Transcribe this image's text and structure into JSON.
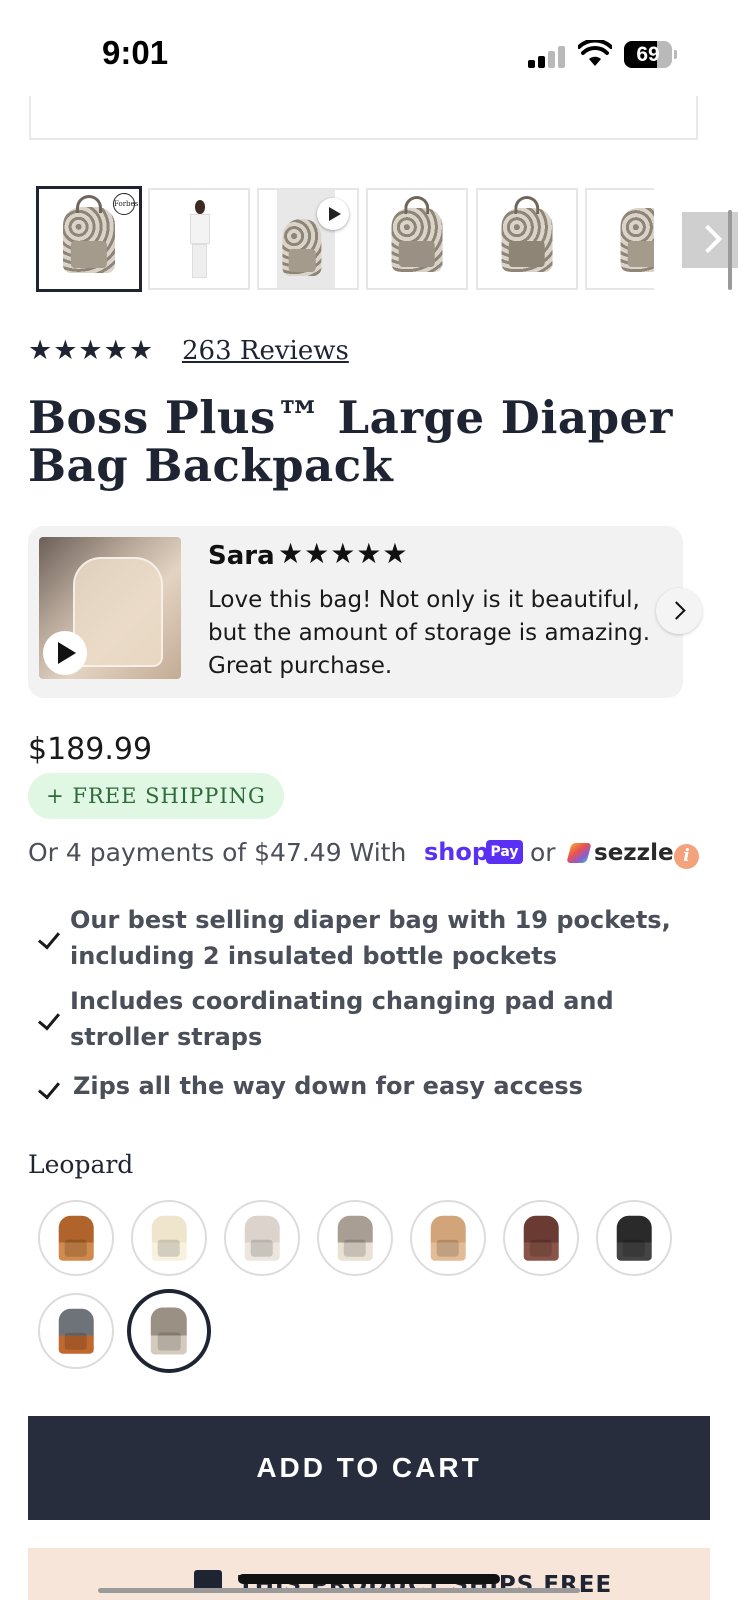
{
  "status_bar": {
    "time": "9:01",
    "battery": "69",
    "battery_level": 0.69
  },
  "gallery": {
    "thumbnails": [
      {
        "kind": "image",
        "badge": "Forbes",
        "selected": true
      },
      {
        "kind": "image",
        "selected": false
      },
      {
        "kind": "video",
        "selected": false
      },
      {
        "kind": "image",
        "selected": false
      },
      {
        "kind": "image",
        "selected": false
      },
      {
        "kind": "image",
        "selected": false
      }
    ],
    "next_icon": "chevron-right-icon"
  },
  "rating": {
    "stars": "★★★★★",
    "reviews_label": "263 Reviews"
  },
  "product": {
    "title": "Boss Plus™ Large Diaper Bag Backpack"
  },
  "review": {
    "name": "Sara",
    "stars": "★★★★★",
    "text": "Love this bag! Not only is it beautiful, but the amount of storage is amazing. Great purchase."
  },
  "pricing": {
    "price": "$189.99",
    "free_shipping": "+ FREE SHIPPING",
    "installments": "Or 4 payments of $47.49 With",
    "shop_logo": "shop",
    "shop_pay": "Pay",
    "or": "or",
    "sezzle": "sezzle",
    "info": "i"
  },
  "features": [
    "Our best selling diaper bag with 19 pockets, including 2 insulated bottle pockets",
    "Includes coordinating changing pad and stroller straps",
    "Zips all the way down for easy access"
  ],
  "color": {
    "selected_name": "Leopard",
    "swatches": [
      {
        "color": "#b0632b",
        "accent": "#d08a4e"
      },
      {
        "color": "#eee5cc",
        "accent": "#f7f1de"
      },
      {
        "color": "#dcd3cc",
        "accent": "#ece6df"
      },
      {
        "color": "#a89e93",
        "accent": "#e9e2d4"
      },
      {
        "color": "#d2a47a",
        "accent": "#e3bc97"
      },
      {
        "color": "#6a3b33",
        "accent": "#8a5548"
      },
      {
        "color": "#2a2a2a",
        "accent": "#444444"
      },
      {
        "color": "#6d7378",
        "accent": "#c0682e"
      },
      {
        "color": "#9a9083",
        "accent": "#d4cabd",
        "selected": true
      }
    ]
  },
  "cta": {
    "add_to_cart": "ADD TO CART"
  },
  "shipping_banner": {
    "text": "THIS PRODUCT SHIPS FREE"
  },
  "colors": {
    "primary": "#272d3d",
    "free_ship_bg": "#dff7e3",
    "shop_purple": "#5a31f4"
  }
}
